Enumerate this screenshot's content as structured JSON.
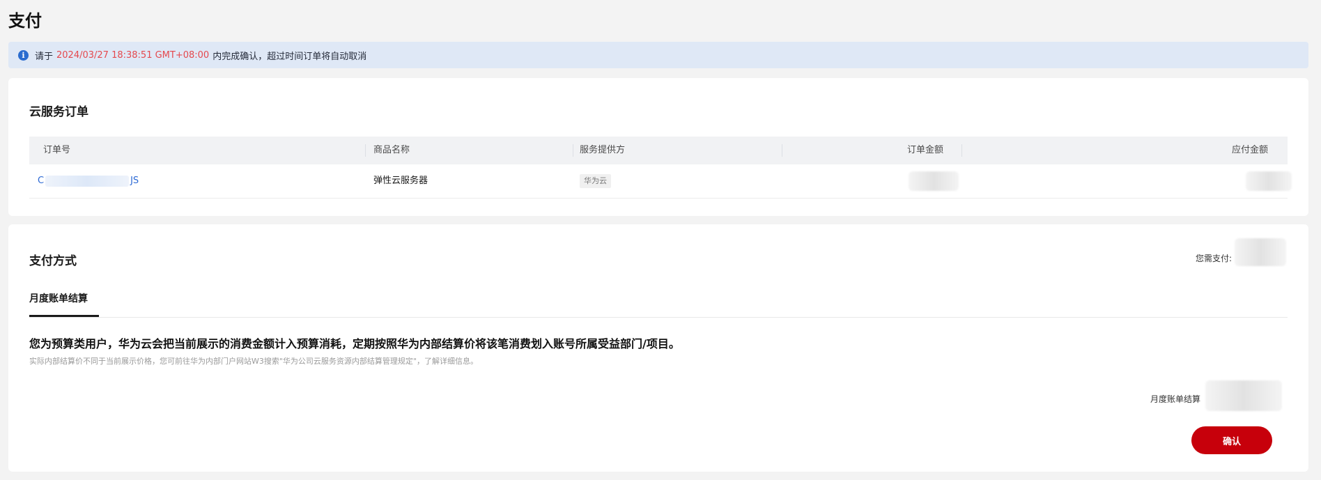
{
  "page": {
    "title": "支付"
  },
  "notice": {
    "prefix": "请于",
    "deadline": "2024/03/27 18:38:51 GMT+08:00",
    "suffix": "内完成确认，超过时间订单将自动取消",
    "icon": "info-icon",
    "highlight_color": "#e5484d"
  },
  "order_section": {
    "title": "云服务订单",
    "columns": [
      "订单号",
      "商品名称",
      "服务提供方",
      "订单金额",
      "应付金额"
    ],
    "rows": [
      {
        "order_no_start": "C",
        "order_no_end": "JS",
        "product": "弹性云服务器",
        "provider": "华为云"
      }
    ]
  },
  "payment_section": {
    "title": "支付方式",
    "need_pay_label": "您需支付:",
    "tab_label": "月度账单结算",
    "main_text": "您为预算类用户，华为云会把当前展示的消费金额计入预算消耗，定期按照华为内部结算价将该笔消费划入账号所属受益部门/项目。",
    "sub_text": "实际内部结算价不同于当前展示价格，您可前往华为内部门户网站W3搜索\"华为公司云服务资源内部结算管理规定\"，了解详细信息。",
    "monthly_label": "月度账单结算",
    "confirm_label": "确认",
    "confirm_color": "#c7000b"
  }
}
